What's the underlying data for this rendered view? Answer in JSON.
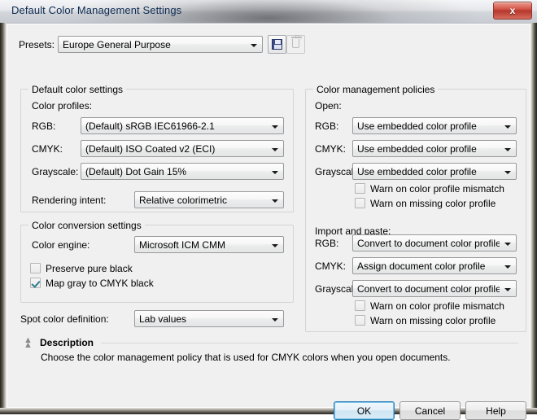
{
  "window": {
    "title": "Default Color Management Settings",
    "close_label": "x"
  },
  "presets": {
    "label": "Presets:",
    "value": "Europe General Purpose",
    "save_icon": "floppy-disk-icon",
    "delete_icon": "trash-icon"
  },
  "default_color_settings": {
    "legend": "Default color settings",
    "color_profiles_label": "Color profiles:",
    "rows": [
      {
        "label": "RGB:",
        "value": "(Default) sRGB IEC61966-2.1"
      },
      {
        "label": "CMYK:",
        "value": "(Default) ISO Coated v2 (ECI)"
      },
      {
        "label": "Grayscale:",
        "value": "(Default) Dot Gain 15%"
      }
    ],
    "rendering_intent_label": "Rendering intent:",
    "rendering_intent_value": "Relative colorimetric"
  },
  "color_conversion_settings": {
    "legend": "Color conversion settings",
    "color_engine_label": "Color engine:",
    "color_engine_value": "Microsoft ICM CMM",
    "checkboxes": [
      {
        "label": "Preserve pure black",
        "checked": false
      },
      {
        "label": "Map gray to CMYK black",
        "checked": true
      }
    ]
  },
  "spot_color": {
    "label": "Spot color definition:",
    "value": "Lab values"
  },
  "color_management_policies": {
    "legend": "Color management policies",
    "open": {
      "heading": "Open:",
      "rows": [
        {
          "label": "RGB:",
          "value": "Use embedded color profile"
        },
        {
          "label": "CMYK:",
          "value": "Use embedded color profile"
        },
        {
          "label": "Grayscale:",
          "value": "Use embedded color profile"
        }
      ],
      "checkboxes": [
        {
          "label": "Warn on color profile mismatch",
          "checked": false
        },
        {
          "label": "Warn on missing color profile",
          "checked": false
        }
      ]
    },
    "import_paste": {
      "heading": "Import and paste:",
      "rows": [
        {
          "label": "RGB:",
          "value": "Convert to document color profile"
        },
        {
          "label": "CMYK:",
          "value": "Assign document color profile"
        },
        {
          "label": "Grayscale:",
          "value": "Convert to document color profile"
        }
      ],
      "checkboxes": [
        {
          "label": "Warn on color profile mismatch",
          "checked": false
        },
        {
          "label": "Warn on missing color profile",
          "checked": false
        }
      ]
    }
  },
  "description": {
    "title": "Description",
    "body": "Choose the color management policy that is used for CMYK colors when you open documents.",
    "collapse_icon": "chevron-double-up-icon"
  },
  "buttons": {
    "ok": "OK",
    "cancel": "Cancel",
    "help": "Help"
  },
  "colors": {
    "accent": "#2c7fb8",
    "title_text": "#0d2a52",
    "dialog_bg": "#f0f0f0",
    "close_button": "#b5372c",
    "checkmark": "#2f7d8c",
    "floppy": "#3d4a8c"
  }
}
